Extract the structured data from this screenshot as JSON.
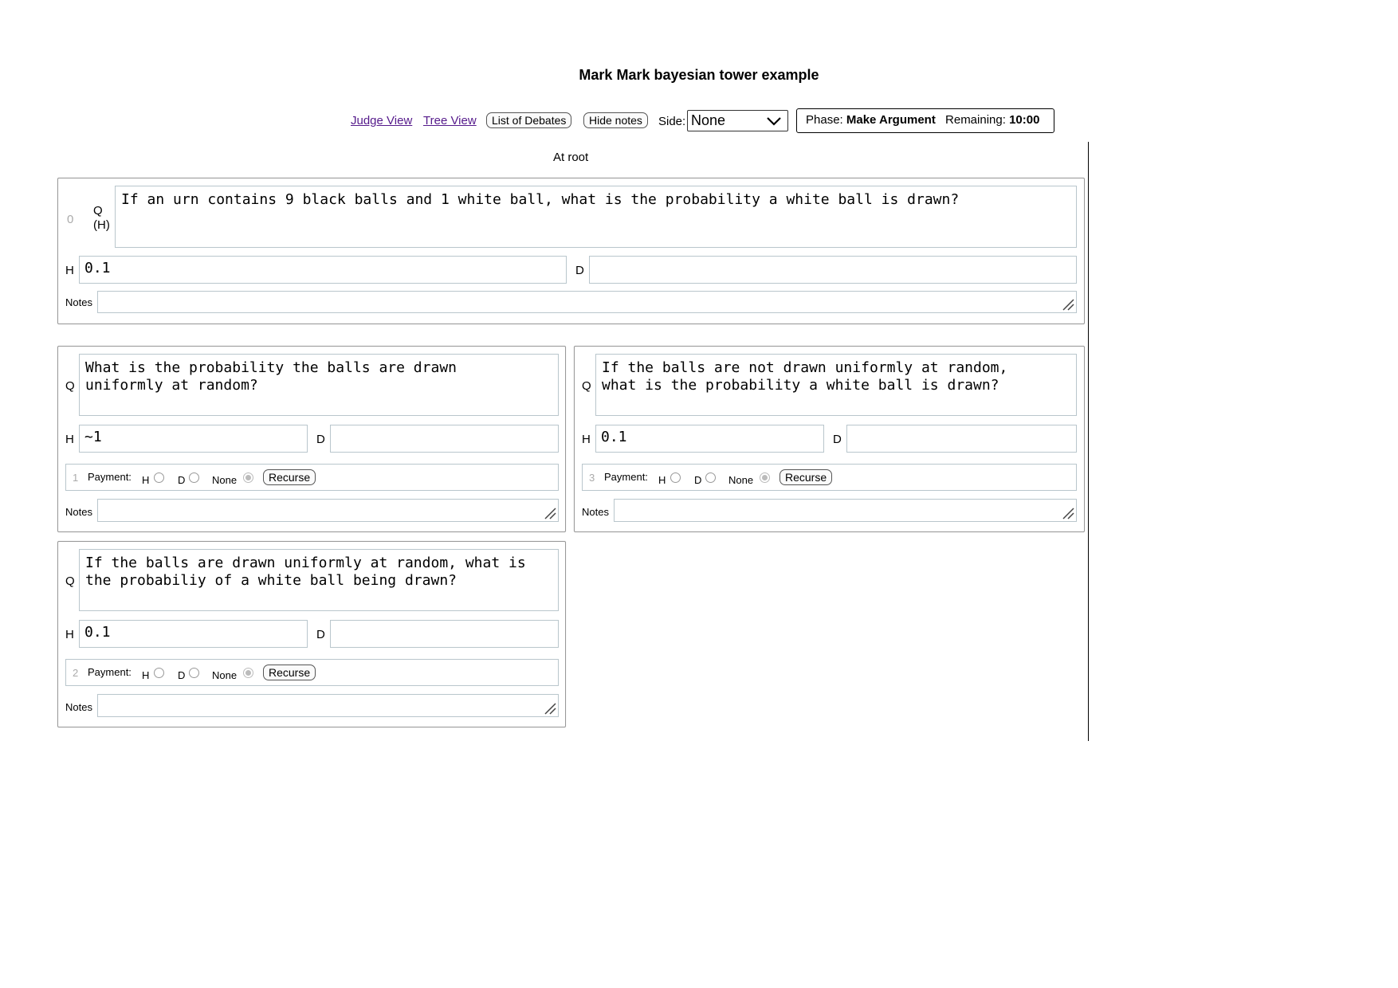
{
  "page": {
    "title": "Mark Mark bayesian tower example",
    "location": "At root"
  },
  "toolbar": {
    "judge_view": "Judge View",
    "tree_view": "Tree View",
    "list_debates": "List of Debates",
    "hide_notes": "Hide notes",
    "side_label": "Side:",
    "side_value": "None",
    "phase_label": "Phase:",
    "phase_value": "Make Argument",
    "remaining_label": "Remaining:",
    "remaining_value": "10:00"
  },
  "root": {
    "index": "0",
    "q_label": "Q",
    "q_sub": "(H)",
    "question": "If an urn contains 9 black balls and 1 white ball, what is the probability a white ball is drawn?",
    "h_label": "H",
    "h_value": "0.1",
    "d_label": "D",
    "d_value": "",
    "notes_label": "Notes"
  },
  "children": [
    {
      "index": "1",
      "q_label": "Q",
      "question": "What is the probability the balls are drawn\nuniformly at random?",
      "h_label": "H",
      "h_value": "~1",
      "d_label": "D",
      "d_value": "",
      "payment_label": "Payment:",
      "opt_h": "H",
      "opt_d": "D",
      "opt_none": "None",
      "selected": "None",
      "recurse": "Recurse",
      "notes_label": "Notes"
    },
    {
      "index": "3",
      "q_label": "Q",
      "question": "If the balls are not drawn uniformly at random,\nwhat is the probability a white ball is drawn?",
      "h_label": "H",
      "h_value": "0.1",
      "d_label": "D",
      "d_value": "",
      "payment_label": "Payment:",
      "opt_h": "H",
      "opt_d": "D",
      "opt_none": "None",
      "selected": "None",
      "recurse": "Recurse",
      "notes_label": "Notes"
    },
    {
      "index": "2",
      "q_label": "Q",
      "question": "If the balls are drawn uniformly at random, what is\nthe probabiliy of a white ball being drawn?",
      "h_label": "H",
      "h_value": "0.1",
      "d_label": "D",
      "d_value": "",
      "payment_label": "Payment:",
      "opt_h": "H",
      "opt_d": "D",
      "opt_none": "None",
      "selected": "None",
      "recurse": "Recurse",
      "notes_label": "Notes"
    }
  ],
  "icons": {
    "dropdown": "chevron-down-icon",
    "resize": "resize-handle-icon"
  }
}
